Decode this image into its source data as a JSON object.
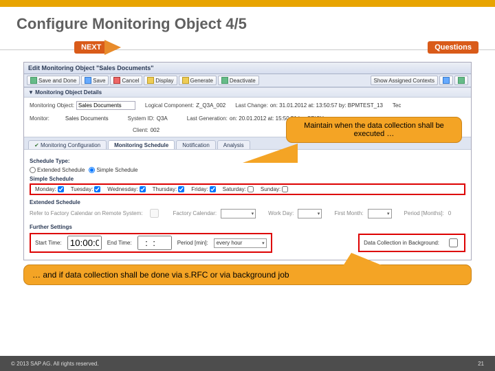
{
  "slide": {
    "title": "Configure Monitoring Object 4/5",
    "next": "NEXT",
    "questions": "Questions"
  },
  "window": {
    "title": "Edit Monitoring Object \"Sales Documents\""
  },
  "toolbar": {
    "save_done": "Save and Done",
    "save": "Save",
    "cancel": "Cancel",
    "display": "Display",
    "generate": "Generate",
    "deactivate": "Deactivate",
    "show_contexts": "Show Assigned Contexts"
  },
  "panel": {
    "title": "Monitoring Object Details"
  },
  "details": {
    "mon_obj_lbl": "Monitoring Object:",
    "mon_obj_val": "Sales Documents",
    "monitor_lbl": "Monitor:",
    "monitor_val": "Sales Documents",
    "log_comp_lbl": "Logical Component:",
    "log_comp_val": "Z_Q3A_002",
    "sys_id_lbl": "System ID:",
    "sys_id_val": "Q3A",
    "client_lbl": "Client:",
    "client_val": "002",
    "last_change_lbl": "Last Change:",
    "last_change_val": "on: 31.01.2012 at: 13:50:57 by: BPMTEST_13",
    "last_gen_lbl": "Last Generation:",
    "last_gen_val": "on: 20.01.2012 at: 15:50:51 by: SPICY",
    "tec": "Tec"
  },
  "tabs": {
    "config": "Monitoring Configuration",
    "schedule": "Monitoring Schedule",
    "notification": "Notification",
    "analysis": "Analysis"
  },
  "schedule": {
    "type_lbl": "Schedule Type:",
    "extended": "Extended Schedule",
    "simple": "Simple Schedule",
    "simple_hdr": "Simple Schedule",
    "days": {
      "mon": "Monday:",
      "tue": "Tuesday:",
      "wed": "Wednesday:",
      "thu": "Thursday:",
      "fri": "Friday:",
      "sat": "Saturday:",
      "sun": "Sunday:"
    },
    "ext_hdr": "Extended Schedule",
    "ext_lbl": "Refer to Factory Calendar on Remote System:",
    "factory_cal": "Factory Calendar:",
    "work_day": "Work Day:",
    "first_month": "First Month:",
    "period_months": "Period [Months]:",
    "period_val": "0",
    "further_hdr": "Further Settings",
    "start_time_lbl": "Start Time:",
    "start_time_val": "10:00:00",
    "end_time_lbl": "End Time:",
    "end_time_val": "  :  :  ",
    "period_min_lbl": "Period [min]:",
    "period_min_val": "every hour",
    "bg_lbl": "Data Collection in Background:"
  },
  "callouts": {
    "c1": "Maintain when the data collection shall be executed …",
    "c2": "… and if data collection shall be done via s.RFC or via background job"
  },
  "footer": {
    "copyright": "© 2013 SAP AG. All rights reserved.",
    "page": "21"
  }
}
